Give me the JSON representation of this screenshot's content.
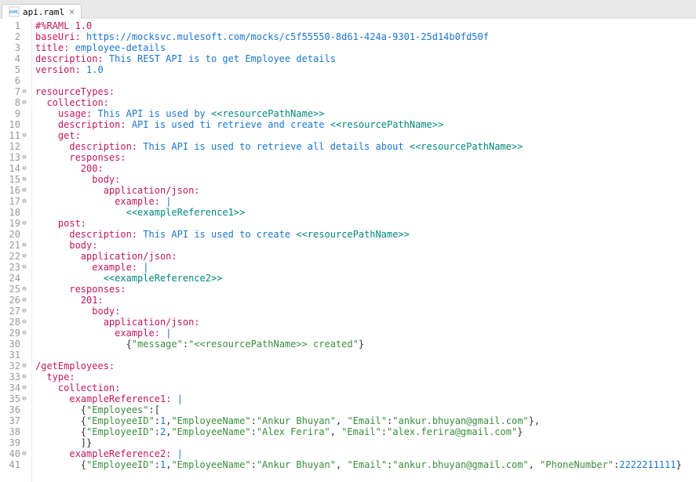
{
  "tab": {
    "filename": "api.raml",
    "close_symbol": "×",
    "icon_label": "RAML"
  },
  "gutter": [
    {
      "n": "1",
      "f": ""
    },
    {
      "n": "2",
      "f": ""
    },
    {
      "n": "3",
      "f": ""
    },
    {
      "n": "4",
      "f": ""
    },
    {
      "n": "5",
      "f": ""
    },
    {
      "n": "6",
      "f": ""
    },
    {
      "n": "7",
      "f": "⊖"
    },
    {
      "n": "8",
      "f": "⊖"
    },
    {
      "n": "9",
      "f": ""
    },
    {
      "n": "10",
      "f": ""
    },
    {
      "n": "11",
      "f": "⊖"
    },
    {
      "n": "12",
      "f": ""
    },
    {
      "n": "13",
      "f": "⊖"
    },
    {
      "n": "14",
      "f": "⊖"
    },
    {
      "n": "15",
      "f": "⊖"
    },
    {
      "n": "16",
      "f": "⊖"
    },
    {
      "n": "17",
      "f": "⊖"
    },
    {
      "n": "18",
      "f": ""
    },
    {
      "n": "19",
      "f": "⊖"
    },
    {
      "n": "20",
      "f": ""
    },
    {
      "n": "21",
      "f": "⊖"
    },
    {
      "n": "22",
      "f": "⊖"
    },
    {
      "n": "23",
      "f": "⊖"
    },
    {
      "n": "24",
      "f": ""
    },
    {
      "n": "25",
      "f": "⊖"
    },
    {
      "n": "26",
      "f": "⊖"
    },
    {
      "n": "27",
      "f": "⊖"
    },
    {
      "n": "28",
      "f": "⊖"
    },
    {
      "n": "29",
      "f": "⊖"
    },
    {
      "n": "30",
      "f": ""
    },
    {
      "n": "31",
      "f": ""
    },
    {
      "n": "32",
      "f": "⊖"
    },
    {
      "n": "33",
      "f": "⊖"
    },
    {
      "n": "34",
      "f": "⊖"
    },
    {
      "n": "35",
      "f": "⊖"
    },
    {
      "n": "36",
      "f": ""
    },
    {
      "n": "37",
      "f": ""
    },
    {
      "n": "38",
      "f": ""
    },
    {
      "n": "39",
      "f": ""
    },
    {
      "n": "40",
      "f": "⊖"
    },
    {
      "n": "41",
      "f": ""
    }
  ],
  "lines": [
    [
      {
        "c": "kw",
        "t": "#%RAML 1.0"
      }
    ],
    [
      {
        "c": "kw",
        "t": "baseUri:"
      },
      {
        "c": "plain",
        "t": " "
      },
      {
        "c": "val",
        "t": "https://mocksvc.mulesoft.com/mocks/c5f55550-8d61-424a-9301-25d14b0fd50f"
      }
    ],
    [
      {
        "c": "kw",
        "t": "title:"
      },
      {
        "c": "plain",
        "t": " "
      },
      {
        "c": "val",
        "t": "employee-details"
      }
    ],
    [
      {
        "c": "kw",
        "t": "description:"
      },
      {
        "c": "plain",
        "t": " "
      },
      {
        "c": "val",
        "t": "This REST API is to get Employee details"
      }
    ],
    [
      {
        "c": "kw",
        "t": "version:"
      },
      {
        "c": "plain",
        "t": " "
      },
      {
        "c": "val",
        "t": "1.0"
      }
    ],
    [],
    [
      {
        "c": "kw",
        "t": "resourceTypes:"
      }
    ],
    [
      {
        "c": "plain",
        "t": "  "
      },
      {
        "c": "kw",
        "t": "collection:"
      }
    ],
    [
      {
        "c": "plain",
        "t": "    "
      },
      {
        "c": "kw",
        "t": "usage:"
      },
      {
        "c": "plain",
        "t": " "
      },
      {
        "c": "val",
        "t": "This API is used by "
      },
      {
        "c": "param",
        "t": "<<resourcePathName>>"
      }
    ],
    [
      {
        "c": "plain",
        "t": "    "
      },
      {
        "c": "kw",
        "t": "description:"
      },
      {
        "c": "plain",
        "t": " "
      },
      {
        "c": "val",
        "t": "API is used ti retrieve and create "
      },
      {
        "c": "param",
        "t": "<<resourcePathName>>"
      }
    ],
    [
      {
        "c": "plain",
        "t": "    "
      },
      {
        "c": "kw",
        "t": "get:"
      }
    ],
    [
      {
        "c": "plain",
        "t": "      "
      },
      {
        "c": "kw",
        "t": "description:"
      },
      {
        "c": "plain",
        "t": " "
      },
      {
        "c": "val",
        "t": "This API is used to retrieve all details about "
      },
      {
        "c": "param",
        "t": "<<resourcePathName>>"
      }
    ],
    [
      {
        "c": "plain",
        "t": "      "
      },
      {
        "c": "kw",
        "t": "responses:"
      }
    ],
    [
      {
        "c": "plain",
        "t": "        "
      },
      {
        "c": "kw",
        "t": "200:"
      }
    ],
    [
      {
        "c": "plain",
        "t": "          "
      },
      {
        "c": "kw",
        "t": "body:"
      }
    ],
    [
      {
        "c": "plain",
        "t": "            "
      },
      {
        "c": "kw",
        "t": "application/json:"
      }
    ],
    [
      {
        "c": "plain",
        "t": "              "
      },
      {
        "c": "kw",
        "t": "example:"
      },
      {
        "c": "plain",
        "t": " "
      },
      {
        "c": "val",
        "t": "|"
      }
    ],
    [
      {
        "c": "plain",
        "t": "                "
      },
      {
        "c": "param",
        "t": "<<exampleReference1>>"
      }
    ],
    [
      {
        "c": "plain",
        "t": "    "
      },
      {
        "c": "kw",
        "t": "post:"
      }
    ],
    [
      {
        "c": "plain",
        "t": "      "
      },
      {
        "c": "kw",
        "t": "description:"
      },
      {
        "c": "plain",
        "t": " "
      },
      {
        "c": "val",
        "t": "This API is used to create "
      },
      {
        "c": "param",
        "t": "<<resourcePathName>>"
      }
    ],
    [
      {
        "c": "plain",
        "t": "      "
      },
      {
        "c": "kw",
        "t": "body:"
      }
    ],
    [
      {
        "c": "plain",
        "t": "        "
      },
      {
        "c": "kw",
        "t": "application/json:"
      }
    ],
    [
      {
        "c": "plain",
        "t": "          "
      },
      {
        "c": "kw",
        "t": "example:"
      },
      {
        "c": "plain",
        "t": " "
      },
      {
        "c": "val",
        "t": "|"
      }
    ],
    [
      {
        "c": "plain",
        "t": "            "
      },
      {
        "c": "param",
        "t": "<<exampleReference2>>"
      }
    ],
    [
      {
        "c": "plain",
        "t": "      "
      },
      {
        "c": "kw",
        "t": "responses:"
      }
    ],
    [
      {
        "c": "plain",
        "t": "        "
      },
      {
        "c": "kw",
        "t": "201:"
      }
    ],
    [
      {
        "c": "plain",
        "t": "          "
      },
      {
        "c": "kw",
        "t": "body:"
      }
    ],
    [
      {
        "c": "plain",
        "t": "            "
      },
      {
        "c": "kw",
        "t": "application/json:"
      }
    ],
    [
      {
        "c": "plain",
        "t": "              "
      },
      {
        "c": "kw",
        "t": "example:"
      },
      {
        "c": "plain",
        "t": " "
      },
      {
        "c": "val",
        "t": "|"
      }
    ],
    [
      {
        "c": "plain",
        "t": "                {"
      },
      {
        "c": "str",
        "t": "\"message\""
      },
      {
        "c": "plain",
        "t": ":"
      },
      {
        "c": "str",
        "t": "\"<<resourcePathName>> created\""
      },
      {
        "c": "plain",
        "t": "}"
      }
    ],
    [],
    [
      {
        "c": "kw",
        "t": "/getEmployees:"
      }
    ],
    [
      {
        "c": "plain",
        "t": "  "
      },
      {
        "c": "kw",
        "t": "type:"
      }
    ],
    [
      {
        "c": "plain",
        "t": "    "
      },
      {
        "c": "kw",
        "t": "collection:"
      }
    ],
    [
      {
        "c": "plain",
        "t": "      "
      },
      {
        "c": "kw",
        "t": "exampleReference1:"
      },
      {
        "c": "plain",
        "t": " "
      },
      {
        "c": "val",
        "t": "|"
      }
    ],
    [
      {
        "c": "plain",
        "t": "        {"
      },
      {
        "c": "str",
        "t": "\"Employees\""
      },
      {
        "c": "plain",
        "t": ":["
      }
    ],
    [
      {
        "c": "plain",
        "t": "        {"
      },
      {
        "c": "str",
        "t": "\"EmployeeID\""
      },
      {
        "c": "plain",
        "t": ":"
      },
      {
        "c": "val",
        "t": "1"
      },
      {
        "c": "plain",
        "t": ","
      },
      {
        "c": "str",
        "t": "\"EmployeeName\""
      },
      {
        "c": "plain",
        "t": ":"
      },
      {
        "c": "str",
        "t": "\"Ankur Bhuyan\""
      },
      {
        "c": "plain",
        "t": ", "
      },
      {
        "c": "str",
        "t": "\"Email\""
      },
      {
        "c": "plain",
        "t": ":"
      },
      {
        "c": "str",
        "t": "\"ankur.bhuyan@gmail.com\""
      },
      {
        "c": "plain",
        "t": "},"
      }
    ],
    [
      {
        "c": "plain",
        "t": "        {"
      },
      {
        "c": "str",
        "t": "\"EmployeeID\""
      },
      {
        "c": "plain",
        "t": ":"
      },
      {
        "c": "val",
        "t": "2"
      },
      {
        "c": "plain",
        "t": ","
      },
      {
        "c": "str",
        "t": "\"EmployeeName\""
      },
      {
        "c": "plain",
        "t": ":"
      },
      {
        "c": "str",
        "t": "\"Alex Ferira\""
      },
      {
        "c": "plain",
        "t": ", "
      },
      {
        "c": "str",
        "t": "\"Email\""
      },
      {
        "c": "plain",
        "t": ":"
      },
      {
        "c": "str",
        "t": "\"alex.ferira@gmail.com\""
      },
      {
        "c": "plain",
        "t": "}"
      }
    ],
    [
      {
        "c": "plain",
        "t": "        ]}"
      }
    ],
    [
      {
        "c": "plain",
        "t": "      "
      },
      {
        "c": "kw",
        "t": "exampleReference2:"
      },
      {
        "c": "plain",
        "t": " "
      },
      {
        "c": "val",
        "t": "|"
      }
    ],
    [
      {
        "c": "plain",
        "t": "        {"
      },
      {
        "c": "str",
        "t": "\"EmployeeID\""
      },
      {
        "c": "plain",
        "t": ":"
      },
      {
        "c": "val",
        "t": "1"
      },
      {
        "c": "plain",
        "t": ","
      },
      {
        "c": "str",
        "t": "\"EmployeeName\""
      },
      {
        "c": "plain",
        "t": ":"
      },
      {
        "c": "str",
        "t": "\"Ankur Bhuyan\""
      },
      {
        "c": "plain",
        "t": ", "
      },
      {
        "c": "str",
        "t": "\"Email\""
      },
      {
        "c": "plain",
        "t": ":"
      },
      {
        "c": "str",
        "t": "\"ankur.bhuyan@gmail.com\""
      },
      {
        "c": "plain",
        "t": ", "
      },
      {
        "c": "str",
        "t": "\"PhoneNumber\""
      },
      {
        "c": "plain",
        "t": ":"
      },
      {
        "c": "val",
        "t": "2222211111"
      },
      {
        "c": "plain",
        "t": "}"
      }
    ]
  ]
}
